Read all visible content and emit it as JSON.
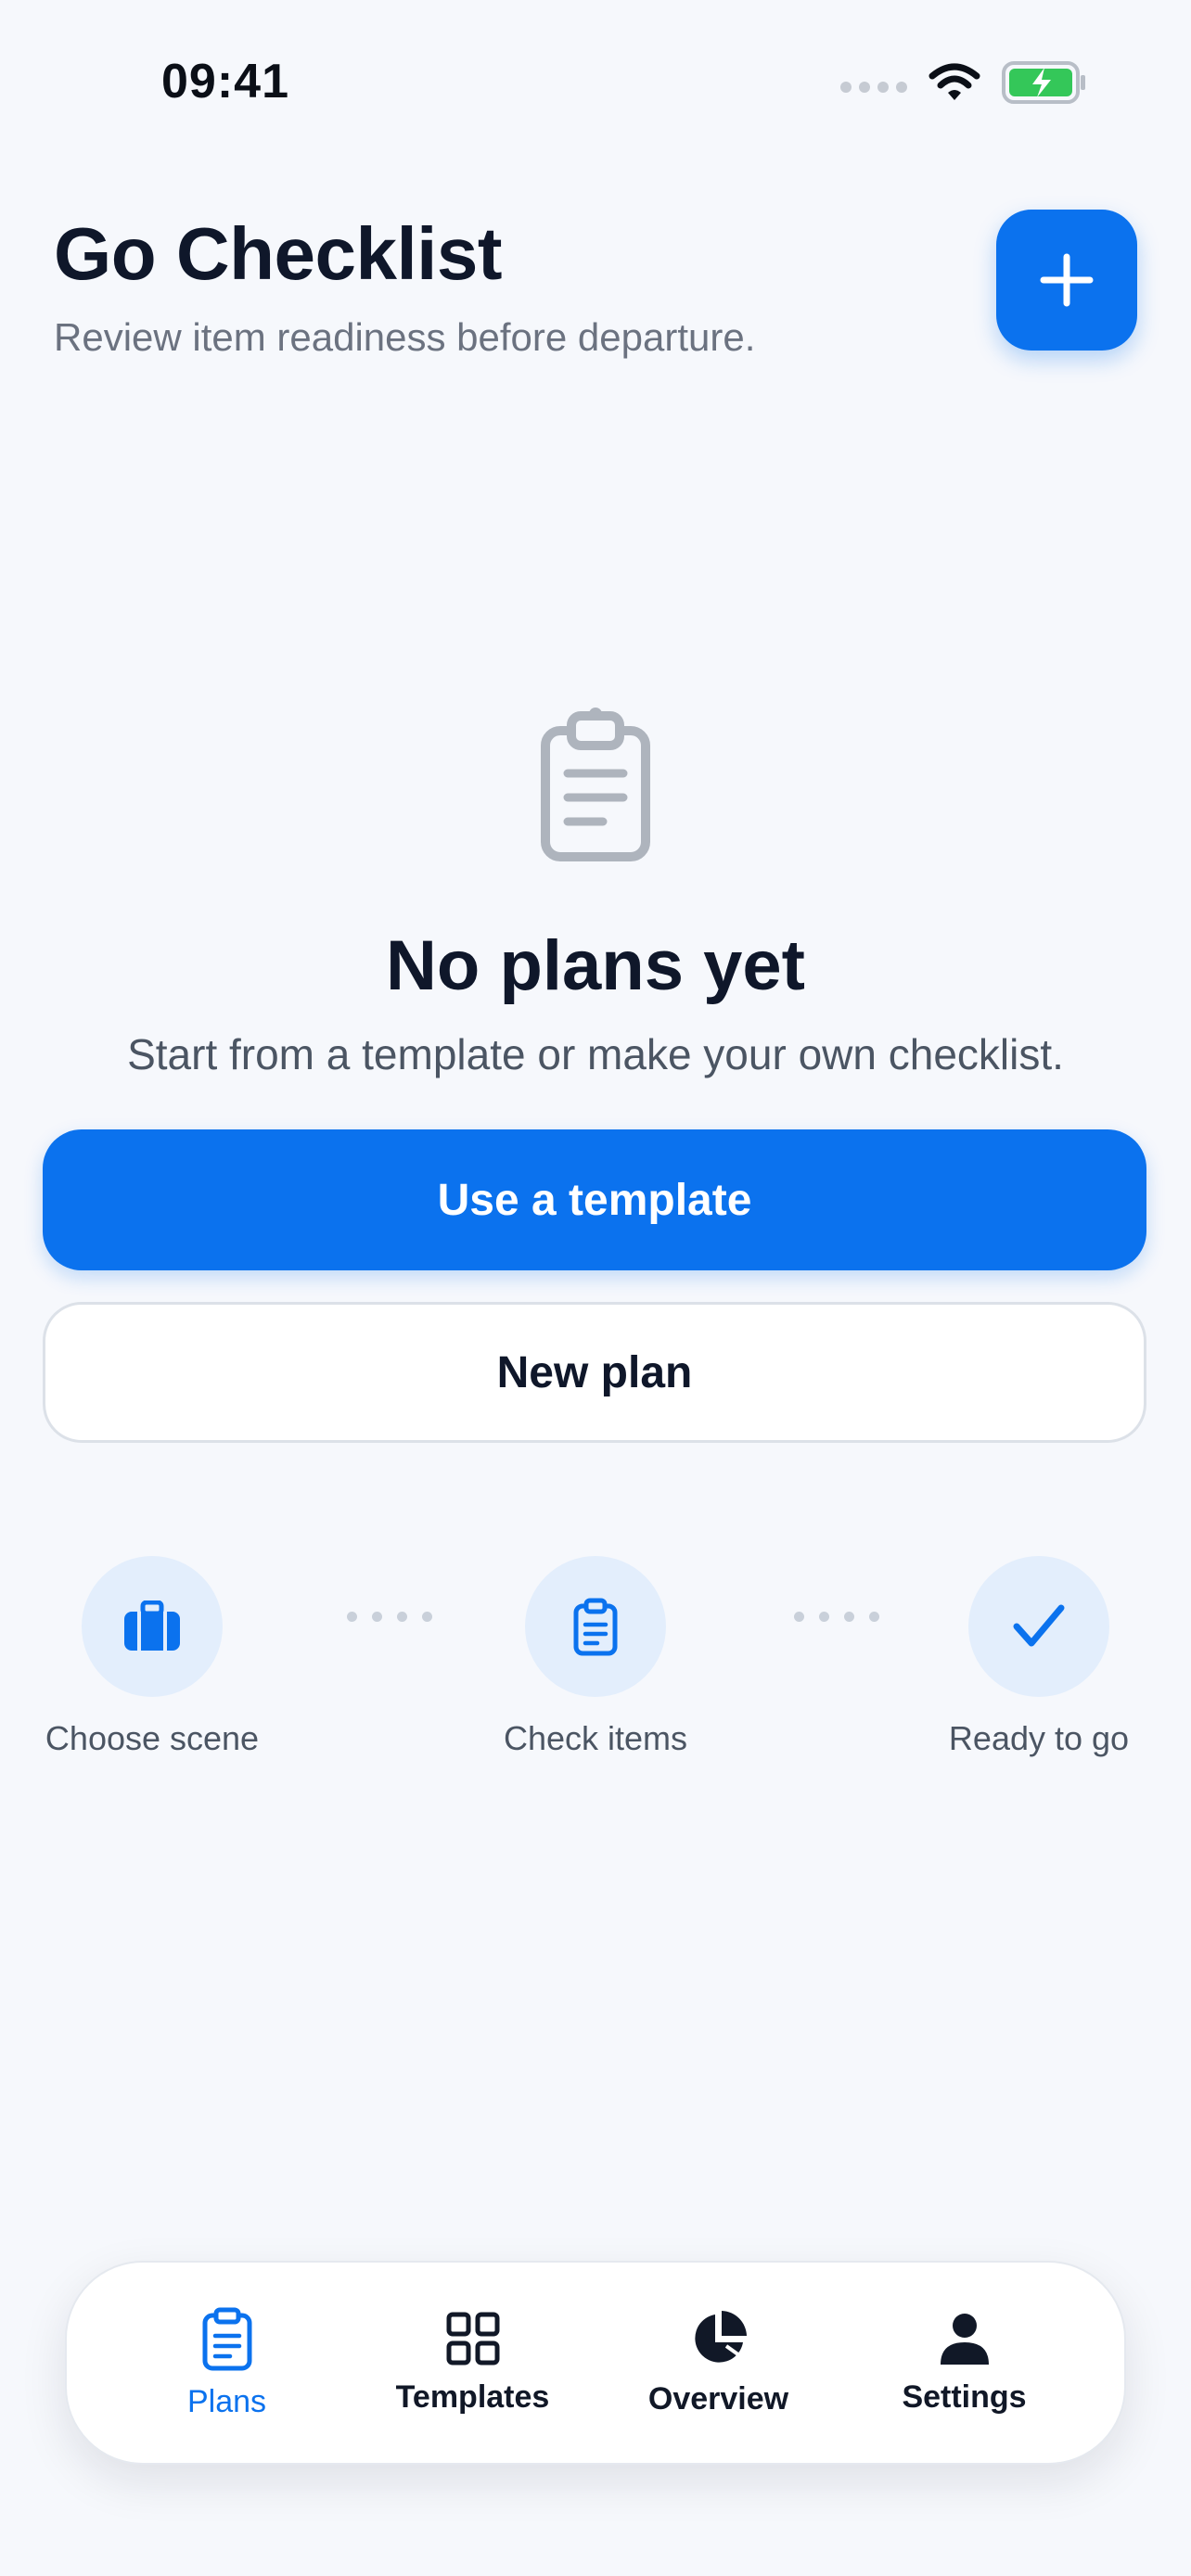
{
  "status_bar": {
    "time": "09:41",
    "icons": [
      "signal-icon",
      "wifi-icon",
      "battery-charging-icon"
    ]
  },
  "header": {
    "title": "Go Checklist",
    "subtitle": "Review item readiness before departure.",
    "add_icon": "plus-icon"
  },
  "empty_state": {
    "icon": "clipboard-icon",
    "title": "No plans yet",
    "subtitle": "Start from a template or make your own checklist."
  },
  "actions": {
    "primary_label": "Use a template",
    "secondary_label": "New plan"
  },
  "steps": [
    {
      "label": "Choose scene",
      "icon": "briefcase-icon"
    },
    {
      "label": "Check items",
      "icon": "clipboard-icon"
    },
    {
      "label": "Ready to go",
      "icon": "checkmark-icon"
    }
  ],
  "tab_bar": {
    "active": "Plans",
    "tabs": [
      {
        "label": "Plans",
        "icon": "clipboard-icon"
      },
      {
        "label": "Templates",
        "icon": "grid-icon"
      },
      {
        "label": "Overview",
        "icon": "pie-chart-icon"
      },
      {
        "label": "Settings",
        "icon": "person-icon"
      }
    ]
  },
  "colors": {
    "accent": "#0B72EE",
    "background": "#F6F8FC",
    "step_circle": "#E3EEFC",
    "battery_fill": "#34C759"
  }
}
